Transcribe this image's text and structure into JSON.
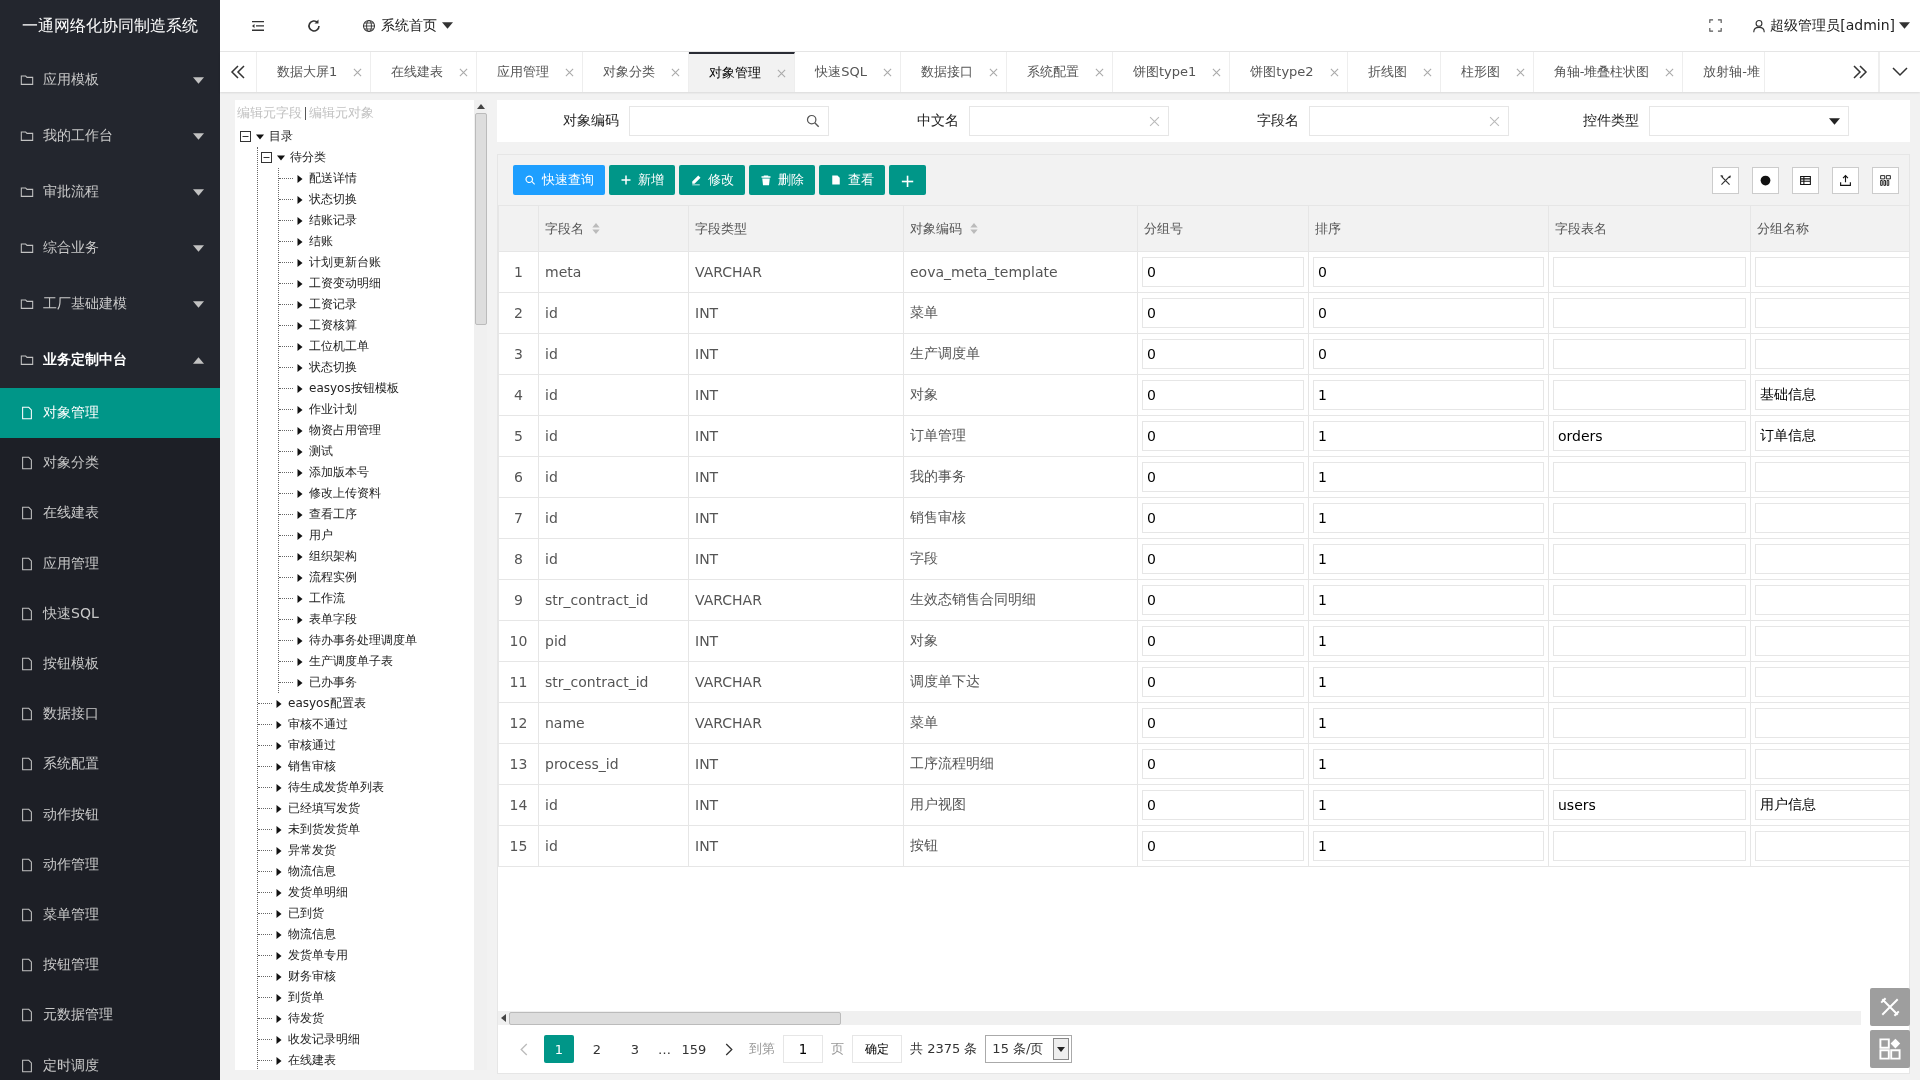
{
  "app_title": "一通网络化协同制造系统",
  "sidebar": {
    "groups": [
      {
        "label": "应用模板",
        "expanded": false
      },
      {
        "label": "我的工作台",
        "expanded": false
      },
      {
        "label": "审批流程",
        "expanded": false
      },
      {
        "label": "综合业务",
        "expanded": false
      },
      {
        "label": "工厂基础建模",
        "expanded": false
      },
      {
        "label": "业务定制中台",
        "expanded": true,
        "items": [
          {
            "label": "对象管理",
            "selected": true
          },
          {
            "label": "对象分类",
            "selected": false
          },
          {
            "label": "在线建表",
            "selected": false
          },
          {
            "label": "应用管理",
            "selected": false
          },
          {
            "label": "快速SQL",
            "selected": false
          },
          {
            "label": "按钮模板",
            "selected": false
          },
          {
            "label": "数据接口",
            "selected": false
          },
          {
            "label": "系统配置",
            "selected": false
          },
          {
            "label": "动作按钮",
            "selected": false
          },
          {
            "label": "动作管理",
            "selected": false
          },
          {
            "label": "菜单管理",
            "selected": false
          },
          {
            "label": "按钮管理",
            "selected": false
          },
          {
            "label": "元数据管理",
            "selected": false
          },
          {
            "label": "定时调度",
            "selected": false
          }
        ]
      }
    ]
  },
  "header": {
    "home_menu": "系统首页",
    "user": "超级管理员[admin]"
  },
  "tabs": [
    {
      "label": "数据大屏1",
      "selected": false
    },
    {
      "label": "在线建表",
      "selected": false
    },
    {
      "label": "应用管理",
      "selected": false
    },
    {
      "label": "对象分类",
      "selected": false
    },
    {
      "label": "对象管理",
      "selected": true
    },
    {
      "label": "快速SQL",
      "selected": false
    },
    {
      "label": "数据接口",
      "selected": false
    },
    {
      "label": "系统配置",
      "selected": false
    },
    {
      "label": "饼图type1",
      "selected": false
    },
    {
      "label": "饼图type2",
      "selected": false
    },
    {
      "label": "折线图",
      "selected": false
    },
    {
      "label": "柱形图",
      "selected": false
    },
    {
      "label": "角轴-堆叠柱状图",
      "selected": false
    },
    {
      "label": "放射轴-堆",
      "selected": false
    }
  ],
  "tree_panel": {
    "links": [
      "编辑元字段",
      "编辑元对象"
    ],
    "tree": [
      {
        "label": "目录",
        "expanded": true,
        "children": [
          {
            "label": "待分类",
            "expanded": true,
            "children": [
              {
                "label": "配送详情",
                "expanded": false
              },
              {
                "label": "状态切换",
                "expanded": false
              },
              {
                "label": "结账记录",
                "expanded": false
              },
              {
                "label": "结账",
                "expanded": false
              },
              {
                "label": "计划更新台账",
                "expanded": false
              },
              {
                "label": "工资变动明细",
                "expanded": false
              },
              {
                "label": "工资记录",
                "expanded": false
              },
              {
                "label": "工资核算",
                "expanded": false
              },
              {
                "label": "工位机工单",
                "expanded": false
              },
              {
                "label": "状态切换",
                "expanded": false
              },
              {
                "label": "easyos按钮模板",
                "expanded": false
              },
              {
                "label": "作业计划",
                "expanded": false
              },
              {
                "label": "物资占用管理",
                "expanded": false
              },
              {
                "label": "测试",
                "expanded": false
              },
              {
                "label": "添加版本号",
                "expanded": false
              },
              {
                "label": "修改上传资料",
                "expanded": false
              },
              {
                "label": "查看工序",
                "expanded": false
              },
              {
                "label": "用户",
                "expanded": false
              },
              {
                "label": "组织架构",
                "expanded": false
              },
              {
                "label": "流程实例",
                "expanded": false
              },
              {
                "label": "工作流",
                "expanded": false
              },
              {
                "label": "表单字段",
                "expanded": false
              },
              {
                "label": "待办事务处理调度单",
                "expanded": false
              },
              {
                "label": "生产调度单子表",
                "expanded": false
              },
              {
                "label": "已办事务",
                "expanded": false
              }
            ]
          },
          {
            "label": "easyos配置表",
            "expanded": false
          },
          {
            "label": "审核不通过",
            "expanded": false
          },
          {
            "label": "审核通过",
            "expanded": false
          },
          {
            "label": "销售审核",
            "expanded": false
          },
          {
            "label": "待生成发货单列表",
            "expanded": false
          },
          {
            "label": "已经填写发货",
            "expanded": false
          },
          {
            "label": "未到货发货单",
            "expanded": false
          },
          {
            "label": "异常发货",
            "expanded": false
          },
          {
            "label": "物流信息",
            "expanded": false
          },
          {
            "label": "发货单明细",
            "expanded": false
          },
          {
            "label": "已到货",
            "expanded": false
          },
          {
            "label": "物流信息",
            "expanded": false
          },
          {
            "label": "发货单专用",
            "expanded": false
          },
          {
            "label": "财务审核",
            "expanded": false
          },
          {
            "label": "到货单",
            "expanded": false
          },
          {
            "label": "待发货",
            "expanded": false
          },
          {
            "label": "收发记录明细",
            "expanded": false
          },
          {
            "label": "在线建表",
            "expanded": false
          }
        ]
      }
    ]
  },
  "filters": [
    {
      "label": "对象编码",
      "kind": "search"
    },
    {
      "label": "中文名",
      "kind": "clear"
    },
    {
      "label": "字段名",
      "kind": "clear"
    },
    {
      "label": "控件类型",
      "kind": "select"
    }
  ],
  "toolbar": [
    {
      "label": "快速查询",
      "kind": "query"
    },
    {
      "label": "新增",
      "kind": "add"
    },
    {
      "label": "修改",
      "kind": "edit"
    },
    {
      "label": "删除",
      "kind": "delete"
    },
    {
      "label": "查看",
      "kind": "view"
    },
    {
      "label": "+",
      "kind": "more"
    }
  ],
  "table": {
    "columns": [
      {
        "label": "字段名",
        "sortable": true
      },
      {
        "label": "字段类型",
        "sortable": false
      },
      {
        "label": "对象编码",
        "sortable": true
      },
      {
        "label": "分组号",
        "sortable": false
      },
      {
        "label": "排序",
        "sortable": false
      },
      {
        "label": "字段表名",
        "sortable": false
      },
      {
        "label": "分组名称",
        "sortable": false
      }
    ],
    "rows": [
      {
        "no": "1",
        "name": "meta",
        "type": "VARCHAR",
        "object": "eova_meta_template",
        "group": "0",
        "order": "0"
      },
      {
        "no": "2",
        "name": "id",
        "type": "INT",
        "object": "菜单",
        "group": "0",
        "order": "0"
      },
      {
        "no": "3",
        "name": "id",
        "type": "INT",
        "object": "生产调度单",
        "group": "0",
        "order": "0"
      },
      {
        "no": "4",
        "name": "id",
        "type": "INT",
        "object": "对象",
        "group": "0",
        "order": "1",
        "group_name": "基础信息"
      },
      {
        "no": "5",
        "name": "id",
        "type": "INT",
        "object": "订单管理",
        "group": "0",
        "order": "1",
        "table": "orders",
        "group_name": "订单信息"
      },
      {
        "no": "6",
        "name": "id",
        "type": "INT",
        "object": "我的事务",
        "group": "0",
        "order": "1"
      },
      {
        "no": "7",
        "name": "id",
        "type": "INT",
        "object": "销售审核",
        "group": "0",
        "order": "1"
      },
      {
        "no": "8",
        "name": "id",
        "type": "INT",
        "object": "字段",
        "group": "0",
        "order": "1"
      },
      {
        "no": "9",
        "name": "str_contract_id",
        "type": "VARCHAR",
        "object": "生效态销售合同明细",
        "group": "0",
        "order": "1"
      },
      {
        "no": "10",
        "name": "pid",
        "type": "INT",
        "object": "对象",
        "group": "0",
        "order": "1"
      },
      {
        "no": "11",
        "name": "str_contract_id",
        "type": "VARCHAR",
        "object": "调度单下达",
        "group": "0",
        "order": "1"
      },
      {
        "no": "12",
        "name": "name",
        "type": "VARCHAR",
        "object": "菜单",
        "group": "0",
        "order": "1"
      },
      {
        "no": "13",
        "name": "process_id",
        "type": "INT",
        "object": "工序流程明细",
        "group": "0",
        "order": "1"
      },
      {
        "no": "14",
        "name": "id",
        "type": "INT",
        "object": "用户视图",
        "group": "0",
        "order": "1",
        "table": "users",
        "group_name": "用户信息"
      },
      {
        "no": "15",
        "name": "id",
        "type": "INT",
        "object": "按钮",
        "group": "0",
        "order": "1"
      }
    ]
  },
  "pagination": {
    "pages": [
      {
        "label": "1",
        "selected": true
      },
      {
        "label": "2",
        "selected": false
      },
      {
        "label": "3",
        "selected": false
      },
      {
        "label": "…",
        "kind": "gap"
      },
      {
        "label": "159",
        "selected": false
      }
    ],
    "goto_label": "到第",
    "goto_value": "1",
    "page_unit": "页",
    "confirm": "确定",
    "total": "共 2375 条",
    "page_size": "15 条/页"
  }
}
